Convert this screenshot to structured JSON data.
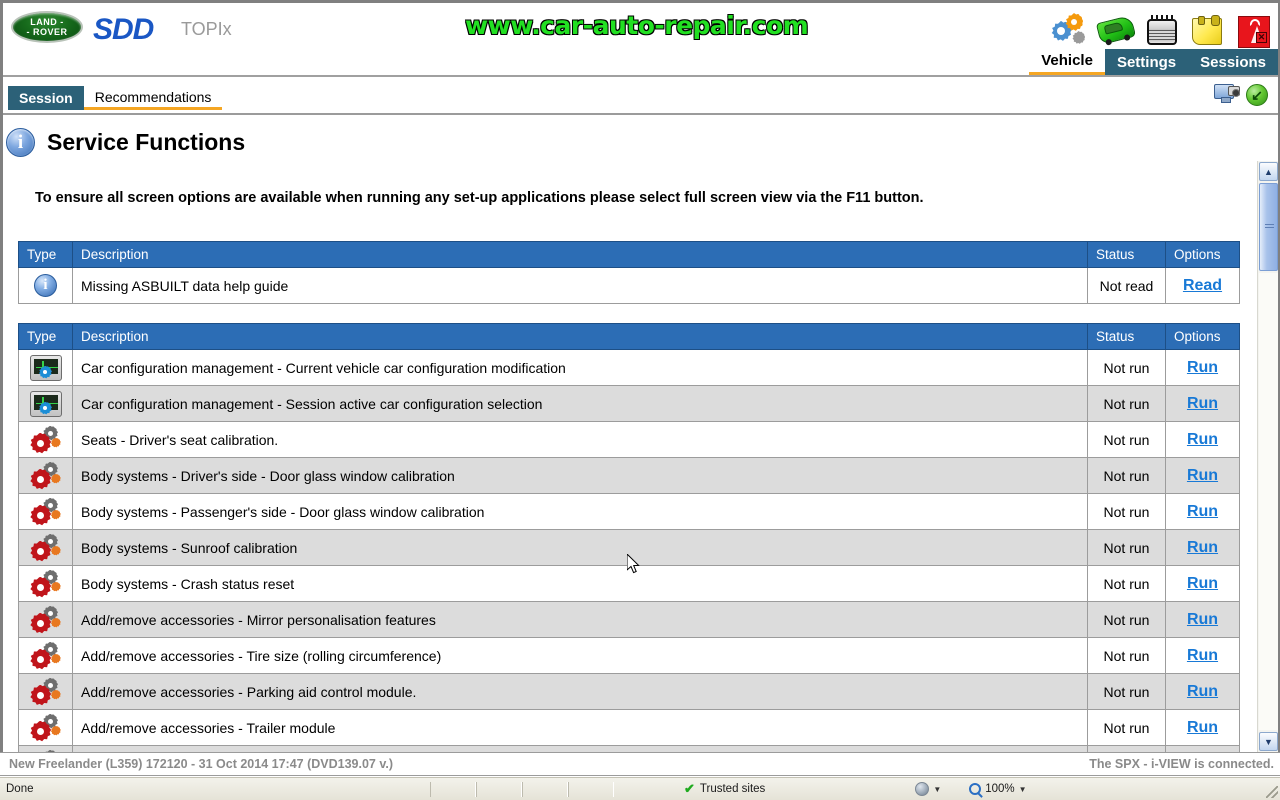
{
  "header": {
    "brand_logo_line1": "LAND -",
    "brand_logo_line2": "- ROVER",
    "app_name": "SDD",
    "portal_name": "TOPIx",
    "watermark": "www.car-auto-repair.com",
    "icons": [
      {
        "name": "gears-icon"
      },
      {
        "name": "vehicle-car-icon"
      },
      {
        "name": "radiator-grille-icon"
      },
      {
        "name": "yellow-note-icon"
      },
      {
        "name": "signal-disconnected-icon"
      }
    ],
    "nav": [
      {
        "label": "Vehicle",
        "active": true
      },
      {
        "label": "Settings",
        "active": false
      },
      {
        "label": "Sessions",
        "active": false
      }
    ]
  },
  "tabstrip": {
    "tabs": [
      {
        "label": "Session",
        "selected": true
      },
      {
        "label": "Recommendations",
        "selected": false
      }
    ],
    "actions": [
      {
        "name": "screenshot-icon"
      },
      {
        "name": "download-icon"
      }
    ]
  },
  "page": {
    "title": "Service Functions",
    "title_icon": "info-icon",
    "notice": "To ensure all screen options are available when running any set-up applications please select full screen view via the F11 button."
  },
  "help_table": {
    "columns": [
      "Type",
      "Description",
      "Status",
      "Options"
    ],
    "rows": [
      {
        "icon": "info-icon",
        "description": "Missing ASBUILT data help guide",
        "status": "Not read",
        "option": "Read"
      }
    ]
  },
  "functions_table": {
    "columns": [
      "Type",
      "Description",
      "Status",
      "Options"
    ],
    "rows": [
      {
        "icon": "monitor-config-icon",
        "description": "Car configuration management - Current vehicle car configuration modification",
        "status": "Not run",
        "option": "Run"
      },
      {
        "icon": "monitor-config-icon",
        "description": "Car configuration management - Session active car configuration selection",
        "status": "Not run",
        "option": "Run"
      },
      {
        "icon": "service-gear-icon",
        "description": "Seats - Driver's seat calibration.",
        "status": "Not run",
        "option": "Run"
      },
      {
        "icon": "service-gear-icon",
        "description": "Body systems - Driver's side - Door glass window calibration",
        "status": "Not run",
        "option": "Run"
      },
      {
        "icon": "service-gear-icon",
        "description": "Body systems - Passenger's side - Door glass window calibration",
        "status": "Not run",
        "option": "Run"
      },
      {
        "icon": "service-gear-icon",
        "description": "Body systems - Sunroof calibration",
        "status": "Not run",
        "option": "Run"
      },
      {
        "icon": "service-gear-icon",
        "description": "Body systems - Crash status reset",
        "status": "Not run",
        "option": "Run"
      },
      {
        "icon": "service-gear-icon",
        "description": "Add/remove accessories - Mirror personalisation features",
        "status": "Not run",
        "option": "Run"
      },
      {
        "icon": "service-gear-icon",
        "description": "Add/remove accessories - Tire size (rolling circumference)",
        "status": "Not run",
        "option": "Run"
      },
      {
        "icon": "service-gear-icon",
        "description": "Add/remove accessories - Parking aid control module.",
        "status": "Not run",
        "option": "Run"
      },
      {
        "icon": "service-gear-icon",
        "description": "Add/remove accessories - Trailer module",
        "status": "Not run",
        "option": "Run"
      },
      {
        "icon": "service-gear-icon",
        "description": "",
        "status": "",
        "option": ""
      }
    ]
  },
  "vehicle_bar": {
    "vehicle": "New Freelander (L359) 172120 - 31 Oct 2014 17:47 (DVD139.07 v.)",
    "connection": "The SPX - i-VIEW is connected."
  },
  "browser_status": {
    "state": "Done",
    "zone": "Trusted sites",
    "zoom": "100%"
  },
  "colors": {
    "table_header": "#2c6db5",
    "nav_active_underline": "#f5a623",
    "nav_inactive_bg": "#2c6178",
    "link": "#1879d6",
    "watermark": "#22e022"
  }
}
